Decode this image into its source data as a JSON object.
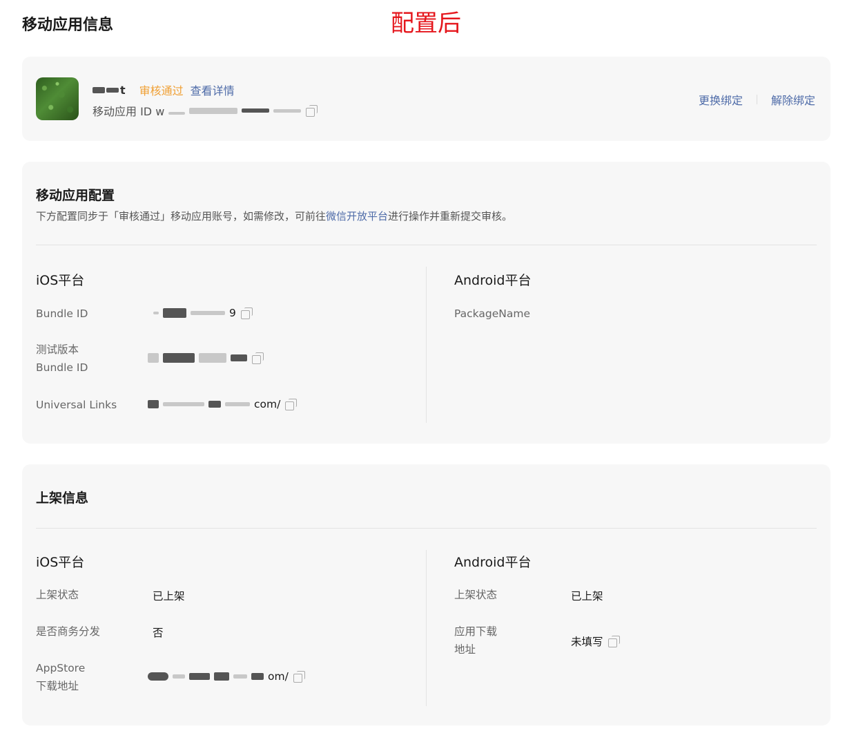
{
  "page": {
    "title": "移动应用信息",
    "banner": "配置后",
    "banner_color": "#e5161c"
  },
  "app": {
    "name_suffix": "t",
    "status": "审核通过",
    "view_details": "查看详情",
    "id_label": "移动应用 ID w",
    "actions": {
      "change_binding": "更换绑定",
      "unbind": "解除绑定"
    }
  },
  "config": {
    "title": "移动应用配置",
    "desc_before": "下方配置同步于「审核通过」移动应用账号，如需修改，可前往",
    "desc_link": "微信开放平台",
    "desc_after": "进行操作并重新提交审核。",
    "ios": {
      "title": "iOS平台",
      "bundle_id_label": "Bundle ID",
      "bundle_id_tail": "9",
      "test_bundle_label_1": "测试版本",
      "test_bundle_label_2": "Bundle ID",
      "universal_links_label": "Universal Links",
      "universal_links_tail": "com/"
    },
    "android": {
      "title": "Android平台",
      "package_name_label": "PackageName"
    }
  },
  "listing": {
    "title": "上架信息",
    "ios": {
      "title": "iOS平台",
      "status_label": "上架状态",
      "status_value": "已上架",
      "business_label": "是否商务分发",
      "business_value": "否",
      "appstore_label_1": "AppStore",
      "appstore_label_2": "下载地址",
      "appstore_tail": "om/"
    },
    "android": {
      "title": "Android平台",
      "status_label": "上架状态",
      "status_value": "已上架",
      "download_label_1": "应用下载",
      "download_label_2": "地址",
      "download_value": "未填写"
    }
  },
  "colors": {
    "accent": "#4e6ba8",
    "approved": "#f0a035",
    "card_bg": "#f7f7f7"
  }
}
